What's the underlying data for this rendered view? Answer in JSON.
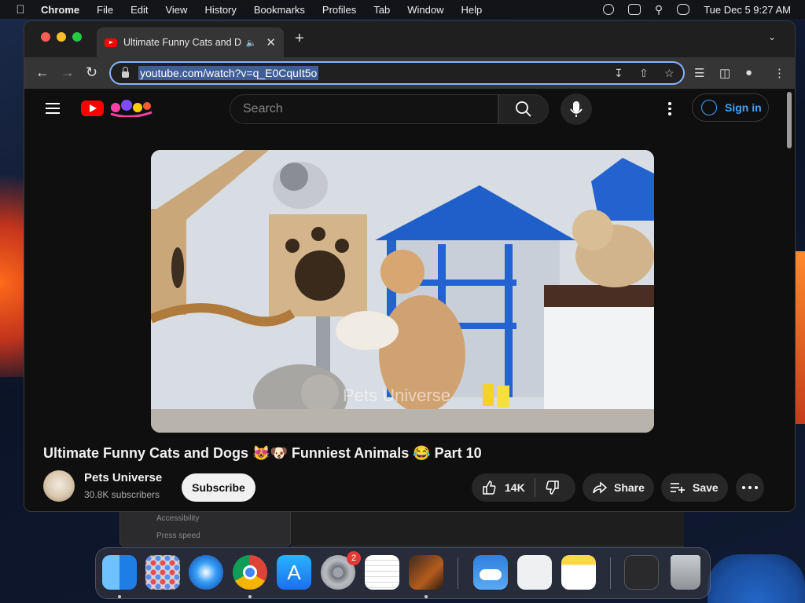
{
  "menubar": {
    "app_name": "Chrome",
    "items": [
      "File",
      "Edit",
      "View",
      "History",
      "Bookmarks",
      "Profiles",
      "Tab",
      "Window",
      "Help"
    ],
    "clock": "Tue Dec 5  9:27 AM"
  },
  "browser": {
    "tab_title": "Ultimate Funny Cats and Dogs",
    "url": "youtube.com/watch?v=q_E0CquIt5o"
  },
  "youtube": {
    "search_placeholder": "Search",
    "sign_in": "Sign in",
    "video_title": "Ultimate Funny Cats and Dogs 😻🐶 Funniest Animals 😂 Part 10",
    "watermark": "Pets Universe",
    "channel_name": "Pets Universe",
    "subscribers": "30.8K subscribers",
    "subscribe_label": "Subscribe",
    "likes": "14K",
    "share_label": "Share",
    "save_label": "Save"
  },
  "background": {
    "snippet1": "Accessibility",
    "snippet2": "Press speed"
  },
  "dock": {
    "apps": [
      "finder-icon",
      "launchpad-icon",
      "safari-icon",
      "chrome-icon",
      "app-store-icon",
      "system-settings-icon",
      "textedit-icon",
      "garageband-icon",
      "weather-icon",
      "system-information-icon",
      "notes-icon",
      "screenshot-icon",
      "trash-icon"
    ],
    "settings_badge": "2"
  },
  "colors": {
    "accent_blue": "#3ea6ff",
    "youtube_red": "#ff0000",
    "omnibox_focus": "#8ab4f8"
  }
}
